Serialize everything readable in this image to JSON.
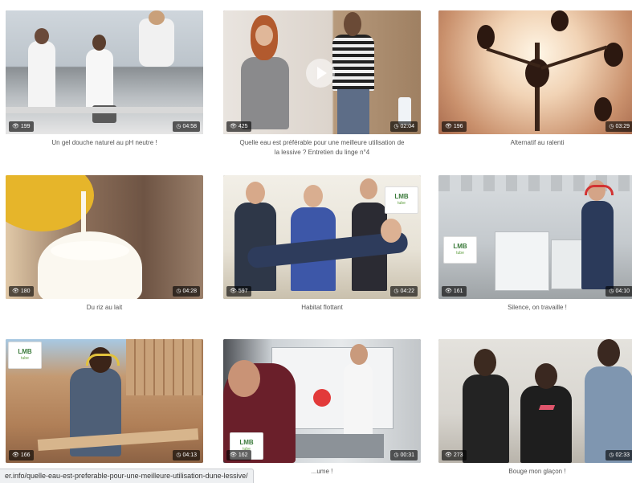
{
  "videos": [
    {
      "title": "Un gel douche naturel au pH neutre !",
      "views": "199",
      "duration": "04:58"
    },
    {
      "title": "Quelle eau est préférable pour une meilleure utilisation de la lessive ? Entretien du linge n°4",
      "views": "425",
      "duration": "02:04"
    },
    {
      "title": "Alternatif au ralenti",
      "views": "196",
      "duration": "03:29"
    },
    {
      "title": "Du riz au lait",
      "views": "180",
      "duration": "04:28"
    },
    {
      "title": "Habitat flottant",
      "views": "597",
      "duration": "04:22"
    },
    {
      "title": "Silence, on travaille !",
      "views": "161",
      "duration": "04:10"
    },
    {
      "title": "",
      "views": "166",
      "duration": "04:13"
    },
    {
      "title": "...ume !",
      "views": "162",
      "duration": "00:31"
    },
    {
      "title": "Bouge mon glaçon !",
      "views": "273",
      "duration": "02:33"
    }
  ],
  "logo": {
    "text": "LMB",
    "sub": "tube"
  },
  "status_url": "er.info/quelle-eau-est-preferable-pour-une-meilleure-utilisation-dune-lessive/",
  "icons": {
    "views": "eye-icon",
    "duration": "clock-icon",
    "play": "play-icon"
  }
}
